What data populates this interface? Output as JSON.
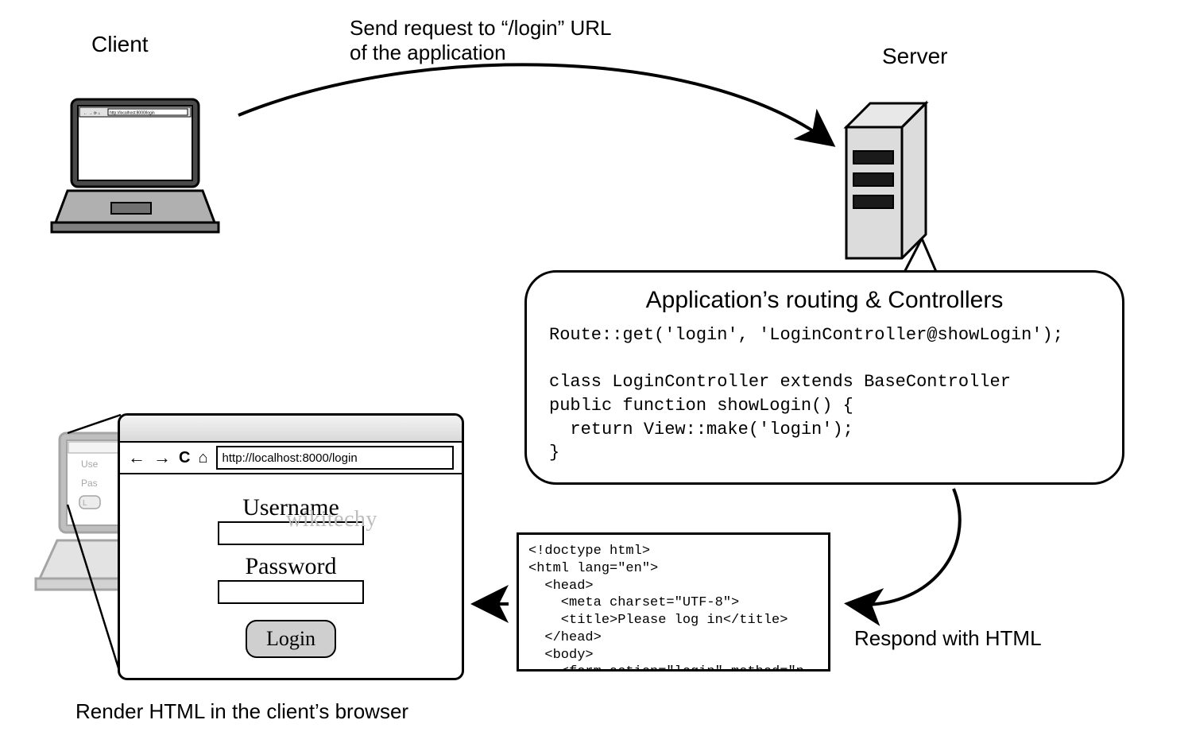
{
  "labels": {
    "client": "Client",
    "server": "Server",
    "request": "Send request to “/login” URL\nof the application",
    "respond": "Respond with HTML",
    "render": "Render HTML in the client’s browser"
  },
  "client_browser_small": {
    "url": "http://localhost:8000/login"
  },
  "server_bubble": {
    "heading": "Application’s routing & Controllers",
    "code": "Route::get('login', 'LoginController@showLogin');\n\nclass LoginController extends BaseController\npublic function showLogin() {\n  return View::make('login');\n}"
  },
  "html_response": {
    "code": "<!doctype html>\n<html lang=\"en\">\n  <head>\n    <meta charset=\"UTF-8\">\n    <title>Please log in</title>\n  </head>\n  <body>\n    <form action=\"login\" method=\"p"
  },
  "browser_window": {
    "url": "http://localhost:8000/login",
    "username_label": "Username",
    "password_label": "Password",
    "login_button": "Login"
  },
  "watermark": "wikitechy"
}
